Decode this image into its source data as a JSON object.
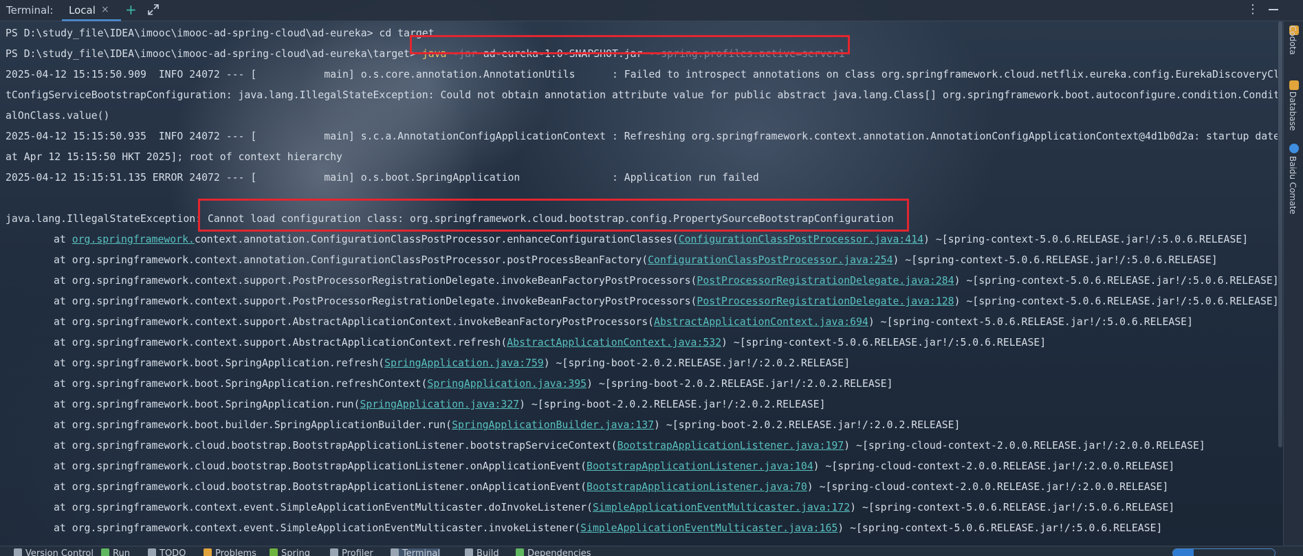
{
  "titlebar": {
    "title": "Terminal:",
    "tab_label": "Local",
    "close_glyph": "×",
    "add_glyph": "+",
    "more_glyph": "⋮"
  },
  "sidebar": {
    "items": [
      {
        "label": "Codota",
        "icon_color": "#e0a43a"
      },
      {
        "label": "Database",
        "icon_color": "#e0a43a"
      },
      {
        "label": "Baidu Comate",
        "icon_color": "#3f8ee0"
      }
    ]
  },
  "terminal": {
    "prompt1": "PS D:\\study_file\\IDEA\\imooc\\imooc-ad-spring-cloud\\ad-eureka> ",
    "cmd1": "cd target",
    "prompt2": "PS D:\\study_file\\IDEA\\imooc\\imooc-ad-spring-cloud\\ad-eureka\\target> ",
    "cmd2_java": "java",
    "cmd2_flag": " -jar ",
    "cmd2_jar": "ad-eureka-1.0-SNAPSHOT.jar",
    "cmd2_profile": " --spring.profiles.active=server1",
    "log_lines": [
      "2025-04-12 15:15:50.909  INFO 24072 --- [           main] o.s.core.annotation.AnnotationUtils      : Failed to introspect annotations on class org.springframework.cloud.netflix.eureka.config.EurekaDiscoveryClien",
      "tConfigServiceBootstrapConfiguration: java.lang.IllegalStateException: Could not obtain annotation attribute value for public abstract java.lang.Class[] org.springframework.boot.autoconfigure.condition.Condition",
      "alOnClass.value()",
      "2025-04-12 15:15:50.935  INFO 24072 --- [           main] s.c.a.AnnotationConfigApplicationContext : Refreshing org.springframework.context.annotation.AnnotationConfigApplicationContext@4d1b0d2a: startup date [S",
      "at Apr 12 15:15:50 HKT 2025]; root of context hierarchy",
      "2025-04-12 15:15:51.135 ERROR 24072 --- [           main] o.s.boot.SpringApplication               : Application run failed"
    ],
    "exception_prefix": "java.lang.IllegalStateException: ",
    "exception_msg": "Cannot load configuration class: org.springframework.cloud.bootstrap.config.PropertySourceBootstrapConfiguration",
    "stack": [
      {
        "pre": "at ",
        "pkg": "org.springframework.",
        "call": "context.annotation.ConfigurationClassPostProcessor.enhanceConfigurationClasses(",
        "link": "ConfigurationClassPostProcessor.java:414",
        "post": ") ~[spring-context-5.0.6.RELEASE.jar!/:5.0.6.RELEASE]"
      },
      {
        "pre": "at ",
        "pkg": "",
        "call": "org.springframework.context.annotation.ConfigurationClassPostProcessor.postProcessBeanFactory(",
        "link": "ConfigurationClassPostProcessor.java:254",
        "post": ") ~[spring-context-5.0.6.RELEASE.jar!/:5.0.6.RELEASE]"
      },
      {
        "pre": "at ",
        "pkg": "",
        "call": "org.springframework.context.support.PostProcessorRegistrationDelegate.invokeBeanFactoryPostProcessors(",
        "link": "PostProcessorRegistrationDelegate.java:284",
        "post": ") ~[spring-context-5.0.6.RELEASE.jar!/:5.0.6.RELEASE]"
      },
      {
        "pre": "at ",
        "pkg": "",
        "call": "org.springframework.context.support.PostProcessorRegistrationDelegate.invokeBeanFactoryPostProcessors(",
        "link": "PostProcessorRegistrationDelegate.java:128",
        "post": ") ~[spring-context-5.0.6.RELEASE.jar!/:5.0.6.RELEASE]"
      },
      {
        "pre": "at ",
        "pkg": "",
        "call": "org.springframework.context.support.AbstractApplicationContext.invokeBeanFactoryPostProcessors(",
        "link": "AbstractApplicationContext.java:694",
        "post": ") ~[spring-context-5.0.6.RELEASE.jar!/:5.0.6.RELEASE]"
      },
      {
        "pre": "at ",
        "pkg": "",
        "call": "org.springframework.context.support.AbstractApplicationContext.refresh(",
        "link": "AbstractApplicationContext.java:532",
        "post": ") ~[spring-context-5.0.6.RELEASE.jar!/:5.0.6.RELEASE]"
      },
      {
        "pre": "at ",
        "pkg": "",
        "call": "org.springframework.boot.SpringApplication.refresh(",
        "link": "SpringApplication.java:759",
        "post": ") ~[spring-boot-2.0.2.RELEASE.jar!/:2.0.2.RELEASE]"
      },
      {
        "pre": "at ",
        "pkg": "",
        "call": "org.springframework.boot.SpringApplication.refreshContext(",
        "link": "SpringApplication.java:395",
        "post": ") ~[spring-boot-2.0.2.RELEASE.jar!/:2.0.2.RELEASE]"
      },
      {
        "pre": "at ",
        "pkg": "",
        "call": "org.springframework.boot.SpringApplication.run(",
        "link": "SpringApplication.java:327",
        "post": ") ~[spring-boot-2.0.2.RELEASE.jar!/:2.0.2.RELEASE]"
      },
      {
        "pre": "at ",
        "pkg": "",
        "call": "org.springframework.boot.builder.SpringApplicationBuilder.run(",
        "link": "SpringApplicationBuilder.java:137",
        "post": ") ~[spring-boot-2.0.2.RELEASE.jar!/:2.0.2.RELEASE]"
      },
      {
        "pre": "at ",
        "pkg": "",
        "call": "org.springframework.cloud.bootstrap.BootstrapApplicationListener.bootstrapServiceContext(",
        "link": "BootstrapApplicationListener.java:197",
        "post": ") ~[spring-cloud-context-2.0.0.RELEASE.jar!/:2.0.0.RELEASE]"
      },
      {
        "pre": "at ",
        "pkg": "",
        "call": "org.springframework.cloud.bootstrap.BootstrapApplicationListener.onApplicationEvent(",
        "link": "BootstrapApplicationListener.java:104",
        "post": ") ~[spring-cloud-context-2.0.0.RELEASE.jar!/:2.0.0.RELEASE]"
      },
      {
        "pre": "at ",
        "pkg": "",
        "call": "org.springframework.cloud.bootstrap.BootstrapApplicationListener.onApplicationEvent(",
        "link": "BootstrapApplicationListener.java:70",
        "post": ") ~[spring-cloud-context-2.0.0.RELEASE.jar!/:2.0.0.RELEASE]"
      },
      {
        "pre": "at ",
        "pkg": "",
        "call": "org.springframework.context.event.SimpleApplicationEventMulticaster.doInvokeListener(",
        "link": "SimpleApplicationEventMulticaster.java:172",
        "post": ") ~[spring-context-5.0.6.RELEASE.jar!/:5.0.6.RELEASE]"
      },
      {
        "pre": "at ",
        "pkg": "",
        "call": "org.springframework.context.event.SimpleApplicationEventMulticaster.invokeListener(",
        "link": "SimpleApplicationEventMulticaster.java:165",
        "post": ") ~[spring-context-5.0.6.RELEASE.jar!/:5.0.6.RELEASE]"
      }
    ]
  },
  "bottombar": {
    "items": [
      {
        "label": "Version Control",
        "icon": "branch-icon",
        "color": "#9aa5b3"
      },
      {
        "label": "Run",
        "icon": "play-icon",
        "color": "#5fb85f"
      },
      {
        "label": "TODO",
        "icon": "list-icon",
        "color": "#9aa5b3"
      },
      {
        "label": "Problems",
        "icon": "warning-icon",
        "color": "#e0a43a"
      },
      {
        "label": "Spring",
        "icon": "leaf-icon",
        "color": "#6db33f"
      },
      {
        "label": "Profiler",
        "icon": "gauge-icon",
        "color": "#9aa5b3"
      },
      {
        "label": "Terminal",
        "icon": "terminal-icon",
        "color": "#9aa5b3"
      },
      {
        "label": "Build",
        "icon": "hammer-icon",
        "color": "#9aa5b3"
      },
      {
        "label": "Dependencies",
        "icon": "package-icon",
        "color": "#5fb85f"
      }
    ],
    "active": "Terminal",
    "progress": 0.2
  },
  "colors": {
    "highlight_box": "#e3262f",
    "link": "#59c2c0",
    "command": "#e8c46a"
  }
}
